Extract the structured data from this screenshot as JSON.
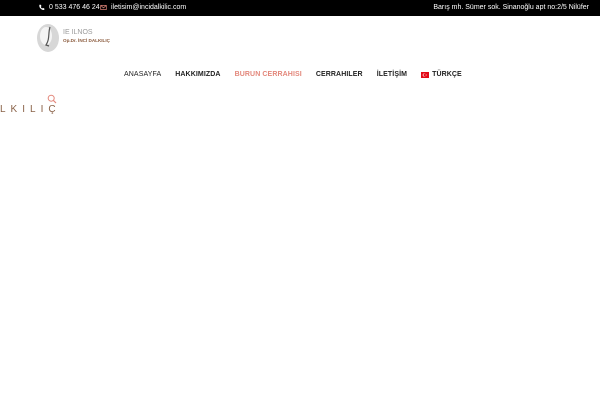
{
  "topbar": {
    "phone": "0 533 476 46 24",
    "email": "iletisim@incidalkilic.com",
    "address": "Barış mh. Sümer sok. Sinanoğlu apt no:2/5 Nilüfer"
  },
  "logo": {
    "line1": "IE ILNOS",
    "line2": "Op.Dr. İNCİ DALKILIÇ"
  },
  "nav": {
    "items": [
      "ANASAYFA",
      "HAKKIMIZDA",
      "BURUN CERRAHISI",
      "CERRAHILER",
      "İLETİŞİM"
    ],
    "language": "TÜRKÇE"
  },
  "brand_fragment": "LKILIÇ",
  "colors": {
    "accent": "#e3877b",
    "topbar": "#000000"
  }
}
